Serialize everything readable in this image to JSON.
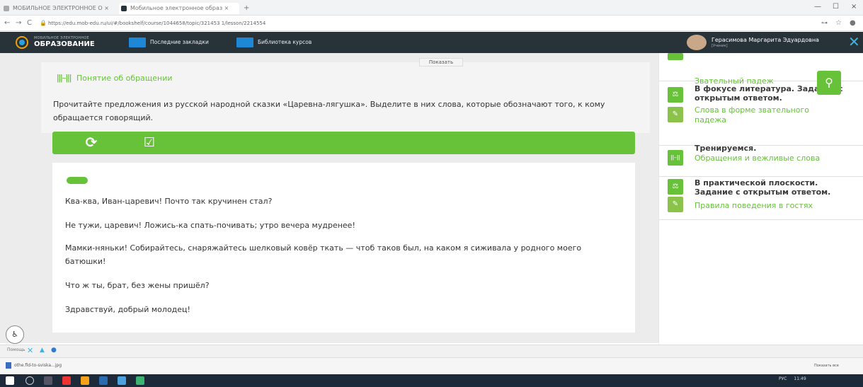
{
  "browser": {
    "tabs": [
      {
        "label": "МОБИЛЬНОЕ ЭЛЕКТРОННОЕ О ×",
        "icon": "page-icon"
      },
      {
        "label": "Мобильное электронное образ ×",
        "icon": "app-icon"
      }
    ],
    "new_tab": "+",
    "url": "https://edu.mob-edu.ru/ui/#/bookshelf/course/1044658/topic/321453 1/lesson/2214554",
    "back": "←",
    "forward": "→",
    "reload": "C",
    "window_controls": [
      "—",
      "☐",
      "×"
    ]
  },
  "header": {
    "logo_small": "МОБИЛЬНОЕ ЭЛЕКТРОННОЕ",
    "logo_main": "ОБРАЗОВАНИЕ",
    "bookmarks_label": "Последние закладки",
    "library_label": "Библиотека курсов",
    "user_name": "Герасимова Маргарита Эдуардовна",
    "user_role": "[Ученик]"
  },
  "main": {
    "show_button": "Показать",
    "section_icon": "ǀǀǀ–ǀǀǀ",
    "section_title": "Понятие об обращении",
    "instruction": "Прочитайте предложения из русской народной сказки «Царевна-лягушка». Выделите в них слова, которые обозначают того, к кому обращается говорящий.",
    "refresh_icon": "⟳",
    "check_icon": "☑",
    "sentences": [
      "Ква-ква, Иван-царевич! Почто так кручинен стал?",
      "Не тужи, царевич! Ложись-ка спать-почивать; утро вечера мудренее!",
      "Мамки-няньки! Собирайтесь, снаряжайтесь шелковый ковёр ткать — чтоб таков был, на каком я сиживала у родного моего батюшки!",
      "Что ж ты, брат, без жены пришёл?",
      "Здравствуй, добрый молодец!"
    ]
  },
  "sidebar": {
    "items": [
      {
        "title": "",
        "sub": "Звательный падеж",
        "icons": [
          "task-icon"
        ]
      },
      {
        "title": "В фокусе литература. Задание с открытым ответом.",
        "sub": "Слова в форме звательного падежа",
        "icons": [
          "scales-icon",
          "pencil-icon"
        ]
      },
      {
        "title": "Тренируемся.",
        "sub": "Обращения и вежливые слова",
        "icons": [
          "practice-icon"
        ]
      },
      {
        "title": "В практической плоскости. Задание с открытым ответом.",
        "sub": "Правила поведения в гостях",
        "icons": [
          "scales-icon",
          "pencil-icon"
        ]
      }
    ]
  },
  "status": {
    "help": "Помощь",
    "download_file": "othe.fld-to-sviska...jpg",
    "show_all": "Показать все",
    "lang": "РУС",
    "time": "11:49"
  },
  "colors": {
    "accent": "#67c23a",
    "header_bg": "#283239",
    "link_blue": "#1e88d6"
  }
}
